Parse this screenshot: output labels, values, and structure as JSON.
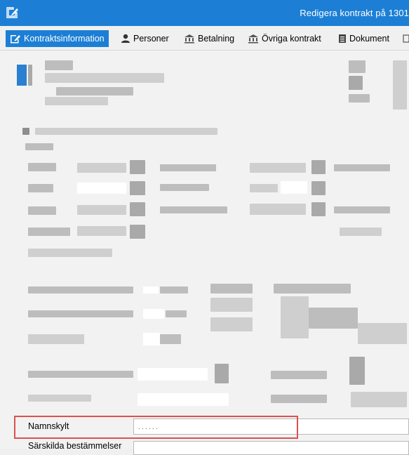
{
  "window": {
    "title": "Redigera kontrakt på 1301"
  },
  "tabs": [
    {
      "label": "Kontraktsinformation",
      "icon": "edit-icon",
      "active": true
    },
    {
      "label": "Personer",
      "icon": "person-icon",
      "active": false
    },
    {
      "label": "Betalning",
      "icon": "building-icon",
      "active": false
    },
    {
      "label": "Övriga kontrakt",
      "icon": "building-icon",
      "active": false
    },
    {
      "label": "Dokument",
      "icon": "document-icon",
      "active": false
    }
  ],
  "form": {
    "namnskylt_label": "Namnskylt",
    "namnskylt_value": ". . .          . . .",
    "sarskilda_label": "Särskilda bestämmelser"
  },
  "colors": {
    "accent": "#1c7fd5",
    "highlight": "#d9534f"
  }
}
